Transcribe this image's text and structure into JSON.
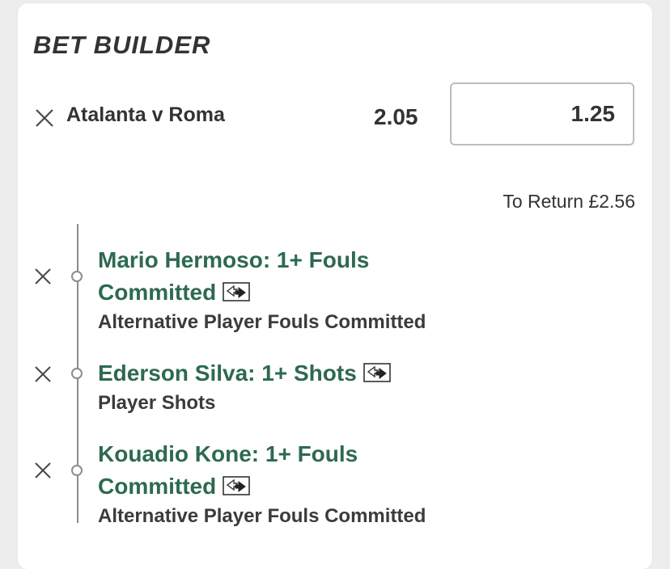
{
  "bet_builder": {
    "title": "BET BUILDER",
    "match": "Atalanta v Roma",
    "odds": "2.05",
    "stake": "1.25",
    "to_return": "To Return £2.56",
    "selections": [
      {
        "title_line1": "Mario Hermoso: 1+ Fouls",
        "title_line2": "Committed",
        "market": "Alternative Player Fouls Committed"
      },
      {
        "title_line1": "Ederson Silva: 1+ Shots",
        "title_line2": "",
        "market": "Player Shots"
      },
      {
        "title_line1": "Kouadio Kone: 1+ Fouls",
        "title_line2": "Committed",
        "market": "Alternative Player Fouls Committed"
      }
    ]
  },
  "icons": {
    "remove": "close-icon",
    "swap": "swap-icon"
  },
  "colors": {
    "selection_title": "#2d6a4f",
    "text": "#333333",
    "background": "#ededee",
    "card": "#ffffff"
  }
}
